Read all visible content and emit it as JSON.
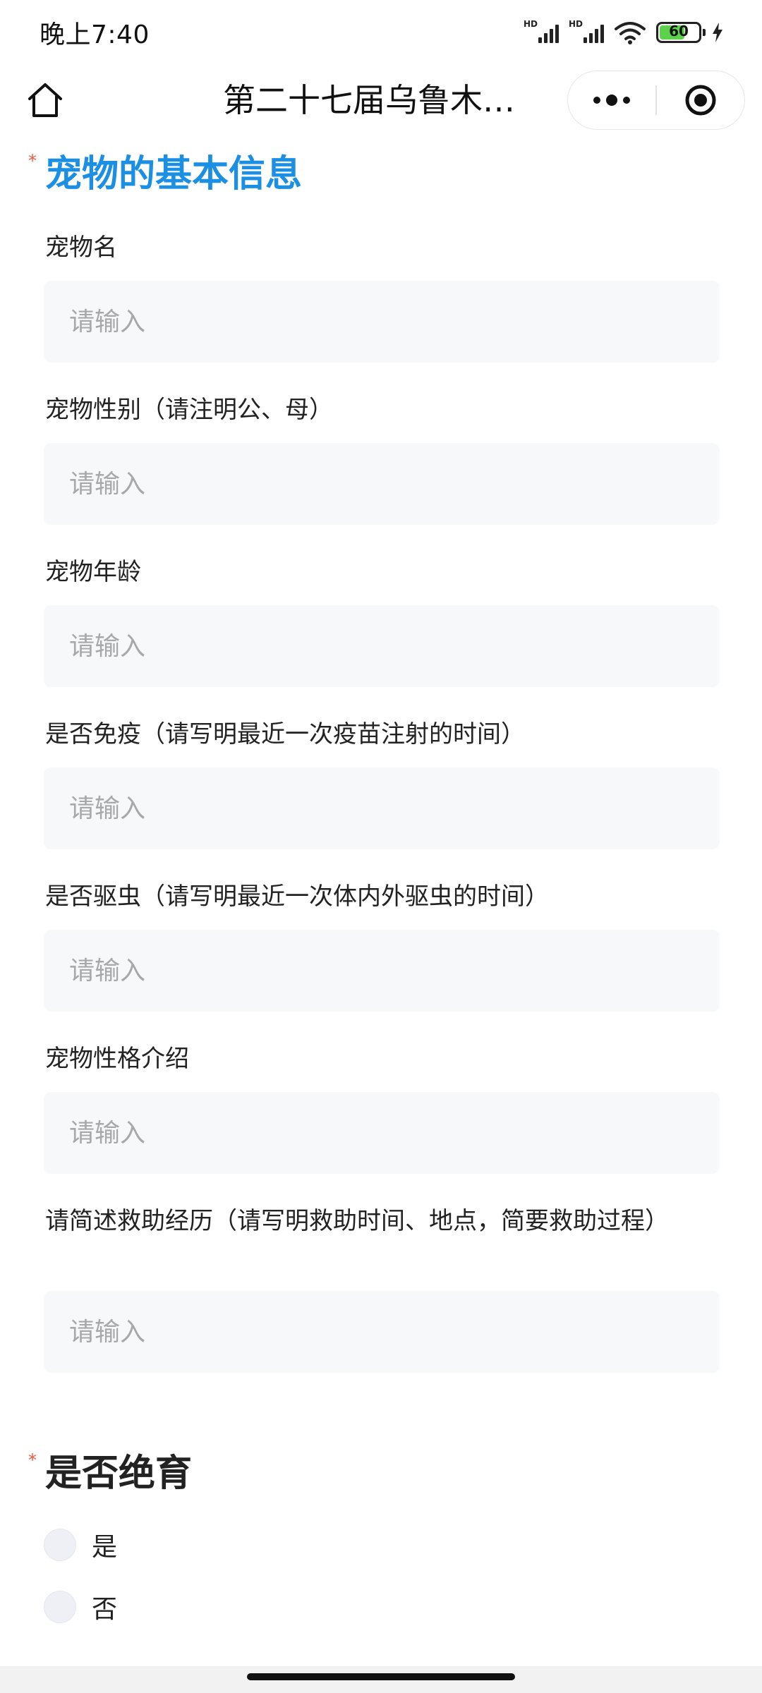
{
  "status_bar": {
    "time": "晚上7:40",
    "hd_label": "HD",
    "battery_level": "60"
  },
  "nav": {
    "title": "第二十七届乌鲁木齐..."
  },
  "section_pet": {
    "title": "宠物的基本信息",
    "required_mark": "*",
    "fields": [
      {
        "label": "宠物名",
        "placeholder": "请输入"
      },
      {
        "label": "宠物性别（请注明公、母）",
        "placeholder": "请输入"
      },
      {
        "label": "宠物年龄",
        "placeholder": "请输入"
      },
      {
        "label": "是否免疫（请写明最近一次疫苗注射的时间）",
        "placeholder": "请输入"
      },
      {
        "label": "是否驱虫（请写明最近一次体内外驱虫的时间）",
        "placeholder": "请输入"
      },
      {
        "label": "宠物性格介绍",
        "placeholder": "请输入"
      },
      {
        "label": "请简述救助经历（请写明救助时间、地点，简要救助过程）",
        "placeholder": "请输入"
      }
    ]
  },
  "section_neuter": {
    "title": "是否绝育",
    "required_mark": "*",
    "options": [
      {
        "label": "是"
      },
      {
        "label": "否"
      }
    ]
  },
  "colors": {
    "accent": "#1a8fe3",
    "required": "#f2543d",
    "input_bg": "#f7f8fa"
  }
}
